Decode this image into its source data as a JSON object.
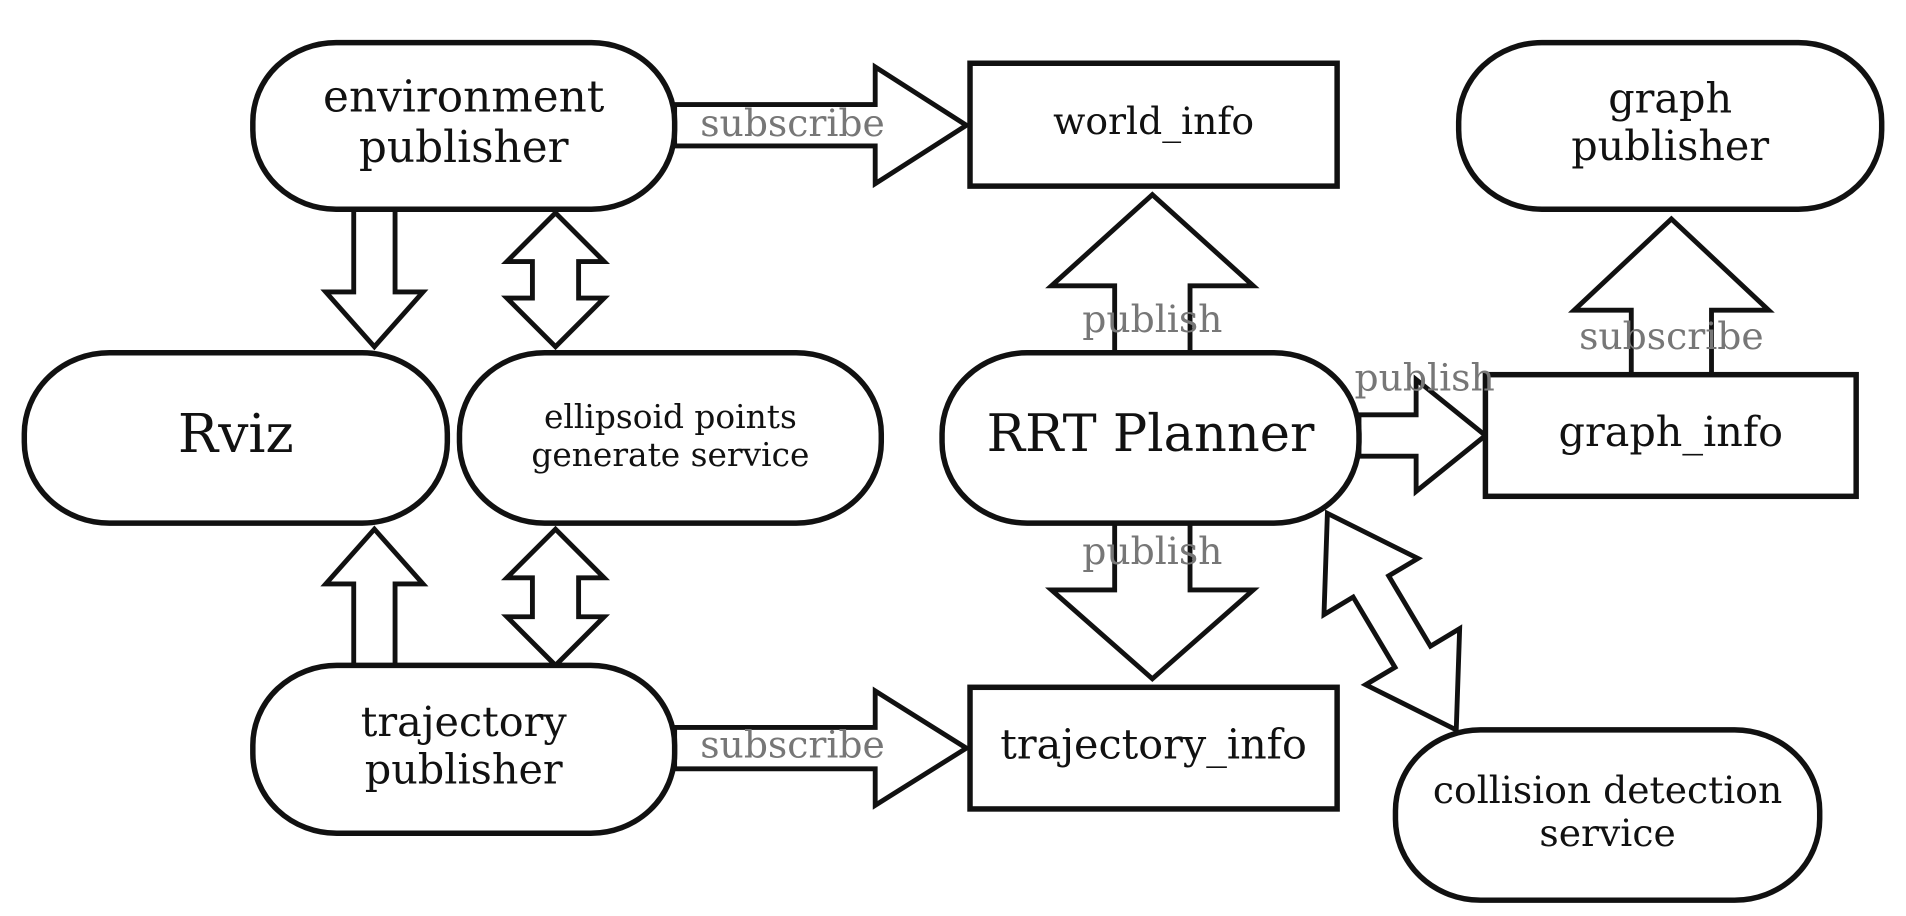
{
  "nodes": {
    "env_pub": {
      "lines": [
        "environment",
        "publisher"
      ],
      "shape": "pill"
    },
    "world_info": {
      "lines": [
        "world_info"
      ],
      "shape": "rect"
    },
    "graph_pub": {
      "lines": [
        "graph",
        "publisher"
      ],
      "shape": "pill"
    },
    "rviz": {
      "lines": [
        "Rviz"
      ],
      "shape": "pill"
    },
    "ellipsoid": {
      "lines": [
        "ellipsoid points",
        "generate service"
      ],
      "shape": "pill"
    },
    "rrt": {
      "lines": [
        "RRT Planner"
      ],
      "shape": "pill"
    },
    "graph_info": {
      "lines": [
        "graph_info"
      ],
      "shape": "rect"
    },
    "traj_pub": {
      "lines": [
        "trajectory",
        "publisher"
      ],
      "shape": "pill"
    },
    "traj_info": {
      "lines": [
        "trajectory_info"
      ],
      "shape": "rect"
    },
    "collision": {
      "lines": [
        "collision detection",
        "service"
      ],
      "shape": "pill"
    }
  },
  "edges": [
    {
      "id": "env-world",
      "from": "env_pub",
      "to": "world_info",
      "label": "subscribe",
      "bidirectional": false
    },
    {
      "id": "traj-trajinfo",
      "from": "traj_pub",
      "to": "traj_info",
      "label": "subscribe",
      "bidirectional": false
    },
    {
      "id": "env-rviz",
      "from": "env_pub",
      "to": "rviz",
      "label": "",
      "bidirectional": false
    },
    {
      "id": "env-ellipsoid",
      "from": "env_pub",
      "to": "ellipsoid",
      "label": "",
      "bidirectional": true
    },
    {
      "id": "traj-rviz",
      "from": "traj_pub",
      "to": "rviz",
      "label": "",
      "bidirectional": false
    },
    {
      "id": "traj-ellipsoid",
      "from": "traj_pub",
      "to": "ellipsoid",
      "label": "",
      "bidirectional": true
    },
    {
      "id": "rrt-world",
      "from": "rrt",
      "to": "world_info",
      "label": "publish",
      "bidirectional": false
    },
    {
      "id": "rrt-trajinfo",
      "from": "rrt",
      "to": "traj_info",
      "label": "publish",
      "bidirectional": false
    },
    {
      "id": "rrt-graphinfo",
      "from": "rrt",
      "to": "graph_info",
      "label": "publish",
      "bidirectional": false
    },
    {
      "id": "graphinfo-graphpub",
      "from": "graph_info",
      "to": "graph_pub",
      "label": "subscribe",
      "bidirectional": false
    },
    {
      "id": "rrt-collision",
      "from": "rrt",
      "to": "collision",
      "label": "",
      "bidirectional": true
    }
  ]
}
